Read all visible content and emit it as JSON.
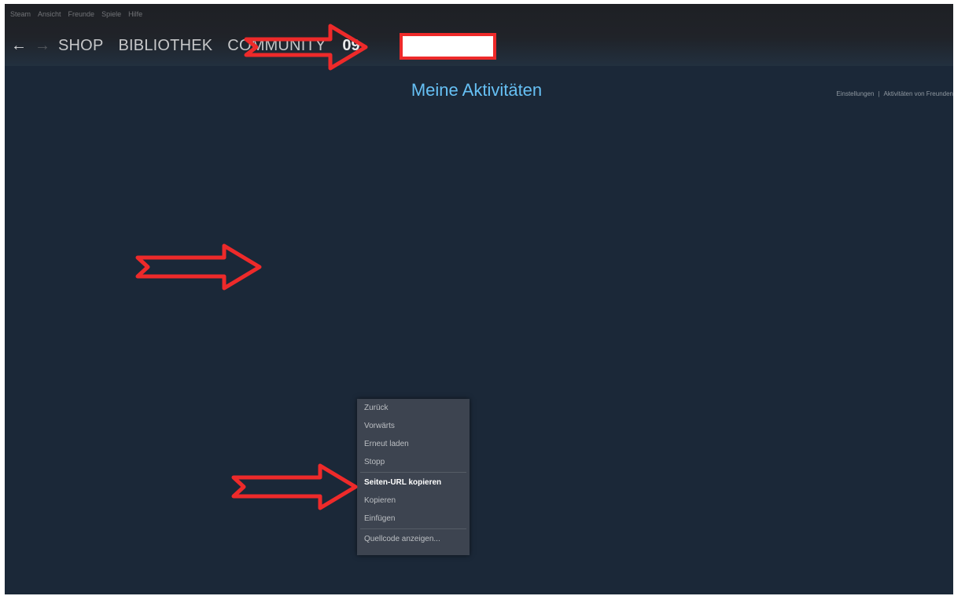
{
  "menubar": {
    "items": [
      "Steam",
      "Ansicht",
      "Freunde",
      "Spiele",
      "Hilfe"
    ]
  },
  "navbar": {
    "back_icon": "←",
    "forward_icon": "→",
    "links": [
      "SHOP",
      "BIBLIOTHEK",
      "COMMUNITY"
    ],
    "username_visible": "09"
  },
  "page": {
    "title": "Meine Aktivitäten",
    "top_links": {
      "settings": "Einstellungen",
      "separator": "|",
      "friends_activity": "Aktivitäten von Freunden"
    }
  },
  "context_menu": {
    "items": [
      {
        "label": "Zurück",
        "bold": false
      },
      {
        "label": "Vorwärts",
        "bold": false
      },
      {
        "label": "Erneut laden",
        "bold": false
      },
      {
        "label": "Stopp",
        "bold": false
      },
      {
        "label": "Seiten-URL kopieren",
        "bold": true
      },
      {
        "label": "Kopieren",
        "bold": false
      },
      {
        "label": "Einfügen",
        "bold": false
      },
      {
        "label": "Quellcode anzeigen...",
        "bold": false
      }
    ]
  },
  "colors": {
    "background": "#1b2838",
    "title_blue": "#66c0f4",
    "annotation_red": "#ee2a2a"
  }
}
